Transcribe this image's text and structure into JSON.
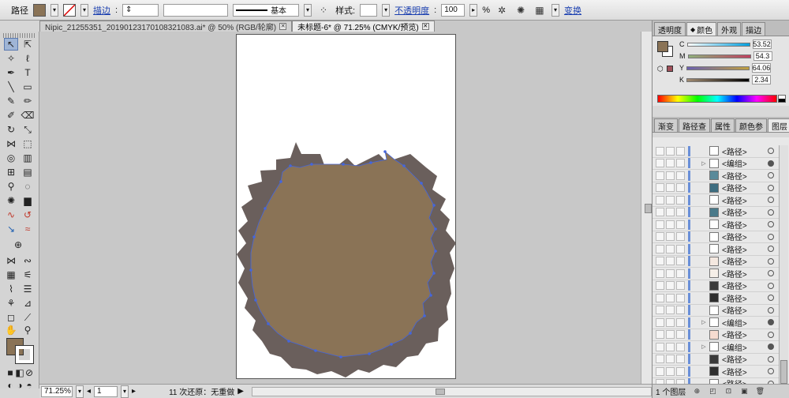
{
  "control_bar": {
    "object_type": "路径",
    "fill_color": "#8a7356",
    "stroke_label": "描边",
    "basic_label": "基本",
    "style_label": "样式:",
    "opacity_label": "不透明度",
    "opacity_value": "100",
    "percent": "%",
    "transform_label": "变换"
  },
  "tabs": [
    {
      "label": "Nipic_21255351_20190123170108321083.ai* @ 50% (RGB/轮廓)",
      "active": false
    },
    {
      "label": "未标题-6* @ 71.25% (CMYK/预览)",
      "active": true
    }
  ],
  "status_bar": {
    "zoom": "71.25%",
    "page": "1",
    "message": "11 次还原：无重做"
  },
  "color_panel": {
    "tabs": [
      "透明度",
      "颜色",
      "外观",
      "描边"
    ],
    "active_tab": "颜色",
    "channels": [
      {
        "name": "C",
        "value": "53.52"
      },
      {
        "name": "M",
        "value": "54.3"
      },
      {
        "name": "Y",
        "value": "64.06"
      },
      {
        "name": "K",
        "value": "2.34"
      }
    ]
  },
  "layers_panel": {
    "tabs": [
      "渐变",
      "路径查",
      "属性",
      "颜色参",
      "图层"
    ],
    "active_tab": "图层",
    "rows": [
      {
        "name": "<路径>",
        "expand": false,
        "target_filled": false
      },
      {
        "name": "<编组>",
        "expand": true,
        "target_filled": true
      },
      {
        "name": "<路径>",
        "expand": false,
        "target_filled": false
      },
      {
        "name": "<路径>",
        "expand": false,
        "target_filled": false
      },
      {
        "name": "<路径>",
        "expand": false,
        "target_filled": false
      },
      {
        "name": "<路径>",
        "expand": false,
        "target_filled": false
      },
      {
        "name": "<路径>",
        "expand": false,
        "target_filled": false
      },
      {
        "name": "<路径>",
        "expand": false,
        "target_filled": false
      },
      {
        "name": "<路径>",
        "expand": false,
        "target_filled": false
      },
      {
        "name": "<路径>",
        "expand": false,
        "target_filled": false
      },
      {
        "name": "<路径>",
        "expand": false,
        "target_filled": false
      },
      {
        "name": "<路径>",
        "expand": false,
        "target_filled": false
      },
      {
        "name": "<路径>",
        "expand": false,
        "target_filled": false
      },
      {
        "name": "<路径>",
        "expand": false,
        "target_filled": false
      },
      {
        "name": "<编组>",
        "expand": true,
        "target_filled": true
      },
      {
        "name": "<路径>",
        "expand": false,
        "target_filled": false
      },
      {
        "name": "<编组>",
        "expand": true,
        "target_filled": true
      },
      {
        "name": "<路径>",
        "expand": false,
        "target_filled": false
      },
      {
        "name": "<路径>",
        "expand": false,
        "target_filled": false
      },
      {
        "name": "<路径>",
        "expand": false,
        "target_filled": false
      },
      {
        "name": "<编组>",
        "expand": true,
        "target_filled": true
      }
    ],
    "layer_count": "1 个图层"
  }
}
